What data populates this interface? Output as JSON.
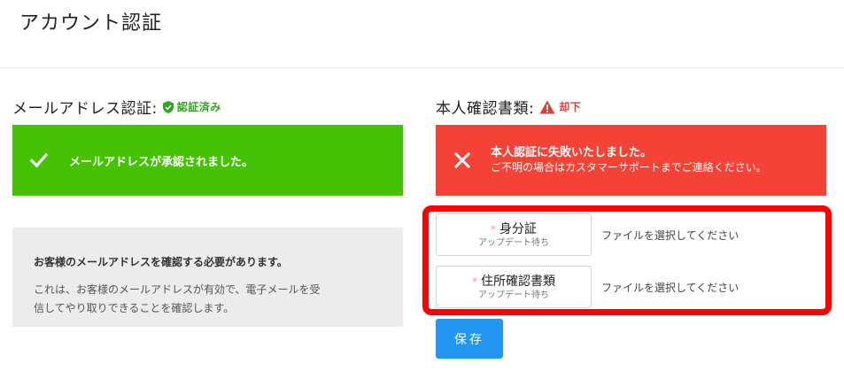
{
  "page": {
    "title": "アカウント認証"
  },
  "email": {
    "heading": "メールアドレス認証:",
    "status_label": "認証済み",
    "status_icon": "shield-check-icon",
    "banner_icon": "check-icon",
    "banner_message": "メールアドレスが承認されました。",
    "info_title": "お客様のメールアドレスを確認する必要があります。",
    "info_body_line1": "これは、お客様のメールアドレスが有効で、電子メールを受",
    "info_body_line2": "信してやり取りできることを確認します。"
  },
  "identity": {
    "heading": "本人確認書類:",
    "status_label": "却下",
    "status_icon": "warning-icon",
    "banner_icon": "close-icon",
    "banner_message": "本人認証に失敗いたしました。",
    "banner_sub": "ご不明の場合はカスタマーサポートまでご連絡ください。",
    "uploads": [
      {
        "required_mark": "*",
        "label": "身分証",
        "status": "アップデート待ち",
        "hint": "ファイルを選択してください"
      },
      {
        "required_mark": "*",
        "label": "住所確認書類",
        "status": "アップデート待ち",
        "hint": "ファイルを選択してください"
      }
    ],
    "save_label": "保存"
  },
  "colors": {
    "success": "#44c203",
    "error": "#f44336",
    "primary": "#2196f3",
    "highlight": "#ff0000"
  }
}
